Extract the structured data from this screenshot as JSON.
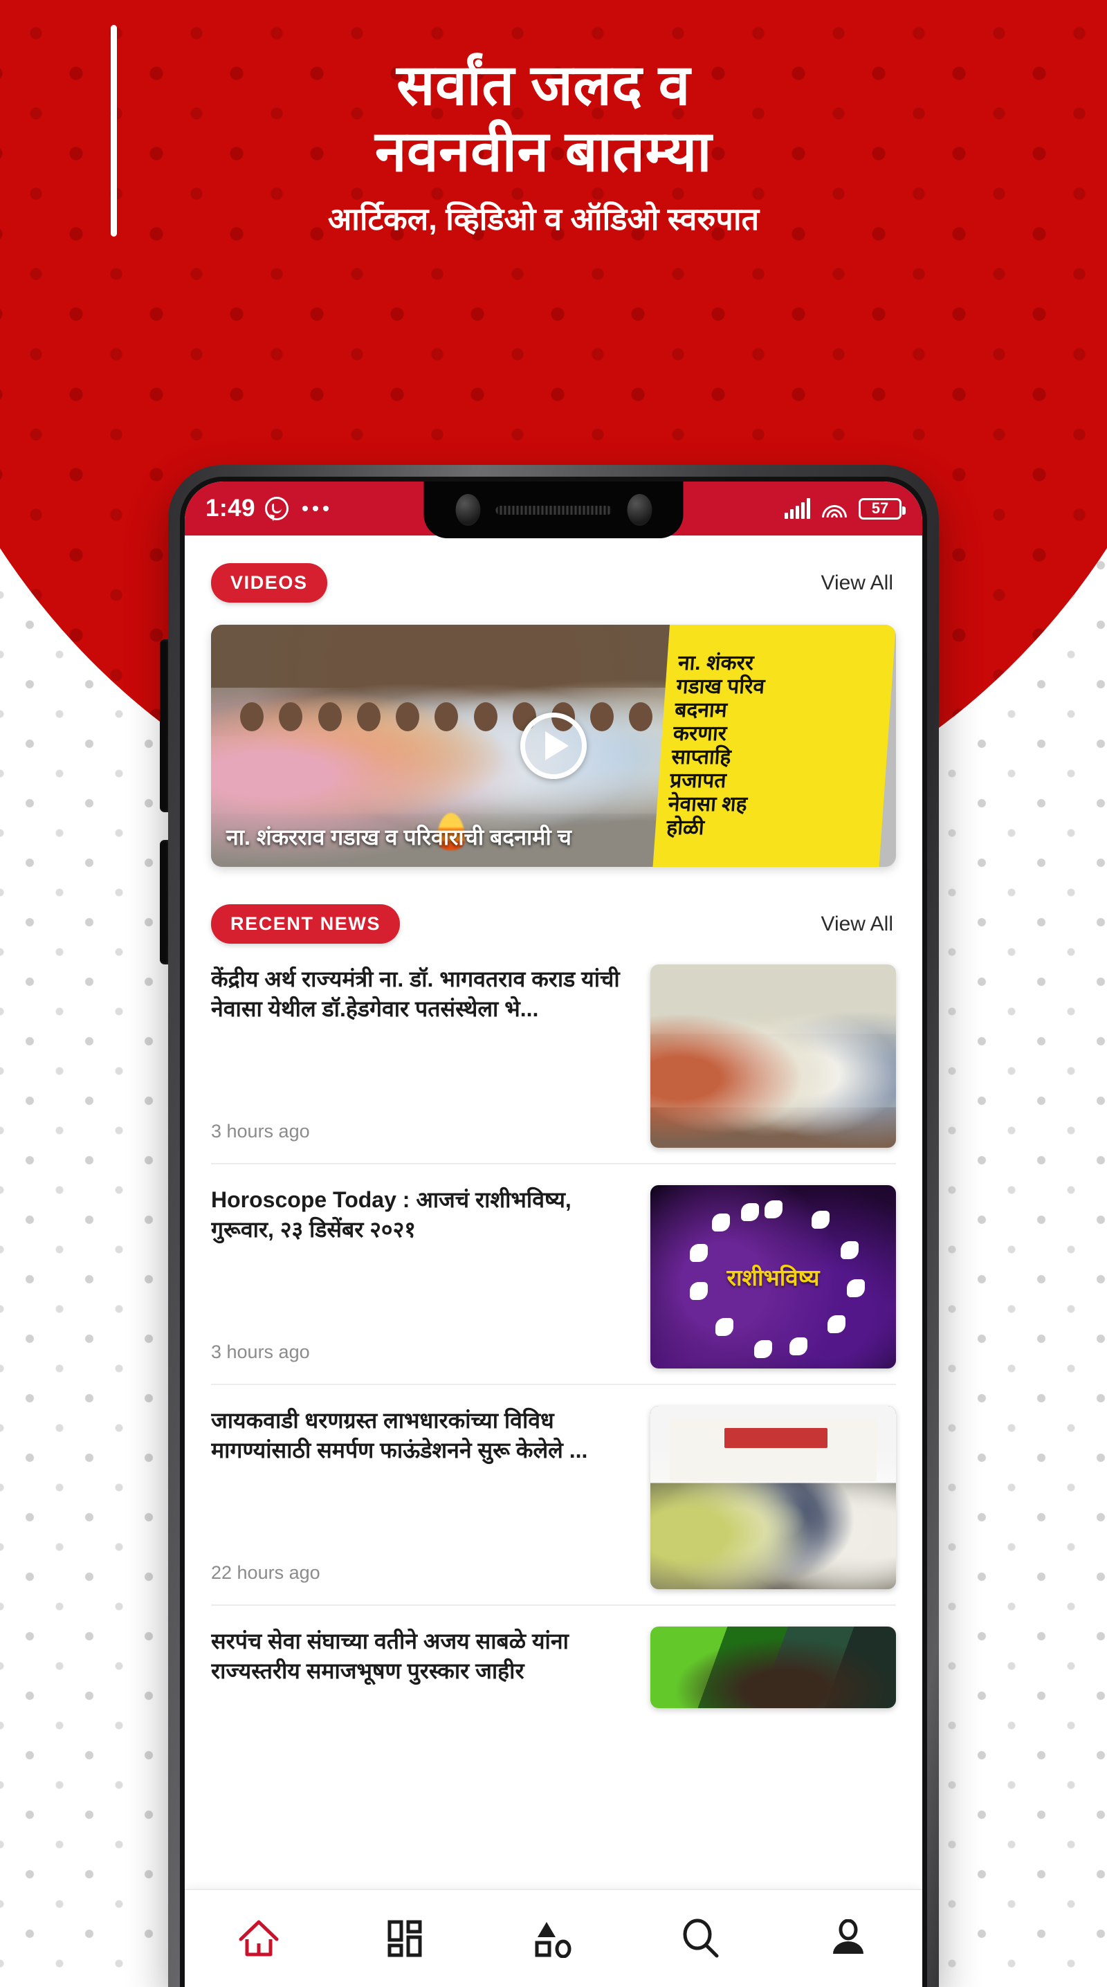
{
  "hero": {
    "headline_line1": "सर्वांत जलद व",
    "headline_line2": "नवनवीन बातम्या",
    "subheadline": "आर्टिकल, व्हिडिओ व ऑडिओ स्वरुपात",
    "background_color": "#c90808",
    "accent_color": "#ffffff"
  },
  "status_bar": {
    "time": "1:49",
    "whatsapp_icon": "whatsapp-icon",
    "overflow_icon": "more-dots-icon",
    "signal_icon": "signal-bars-icon",
    "wifi_icon": "wifi-icon",
    "battery_level": "57",
    "background_color": "#c9122b"
  },
  "videos_section": {
    "badge": "VIDEOS",
    "view_all": "View All",
    "video": {
      "caption": "ना. शंकरराव गडाख व परिवाराची बदनामी च",
      "play_icon": "play-icon",
      "banner_lines": [
        "ना. शंकरर",
        "गडाख परिव",
        "बदनाम",
        "करणार",
        "साप्ताहि",
        "प्रजापत",
        "नेवासा शह",
        "होळी"
      ]
    }
  },
  "recent_news_section": {
    "badge": "RECENT NEWS",
    "view_all": "View All",
    "items": [
      {
        "title": "केंद्रीय अर्थ राज्यमंत्री ना. डॉ. भागवतराव कराड यांची नेवासा येथील डॉ.हेडगेवार पतसंस्थेला भे...",
        "time": "3 hours ago",
        "thumb": "news-photo-felicitation"
      },
      {
        "title": "Horoscope Today : आजचं राशीभविष्य, गुरूवार, २३ डिसेंबर २०२१",
        "time": "3 hours ago",
        "thumb": "news-photo-horoscope",
        "thumb_label": "राशीभविष्य"
      },
      {
        "title": "जायकवाडी धरणग्रस्त लाभधारकांच्या विविध मागण्यांसाठी समर्पण फाऊंडेशनने सुरू केलेले ...",
        "time": "22 hours ago",
        "thumb": "news-photo-samarpan-foundation"
      },
      {
        "title": "सरपंच सेवा संघाच्या वतीने अजय साबळे यांना राज्यस्तरीय समाजभूषण पुरस्कार जाहीर",
        "time": "",
        "thumb": "news-photo-portrait"
      }
    ]
  },
  "bottom_nav": {
    "items": [
      {
        "name": "home",
        "icon": "home-icon",
        "active": true
      },
      {
        "name": "dashboard",
        "icon": "grid-icon",
        "active": false
      },
      {
        "name": "categories",
        "icon": "shapes-icon",
        "active": false
      },
      {
        "name": "search",
        "icon": "search-icon",
        "active": false
      },
      {
        "name": "profile",
        "icon": "person-icon",
        "active": false
      }
    ],
    "active_color": "#c9122b",
    "inactive_color": "#1b1b1b"
  }
}
